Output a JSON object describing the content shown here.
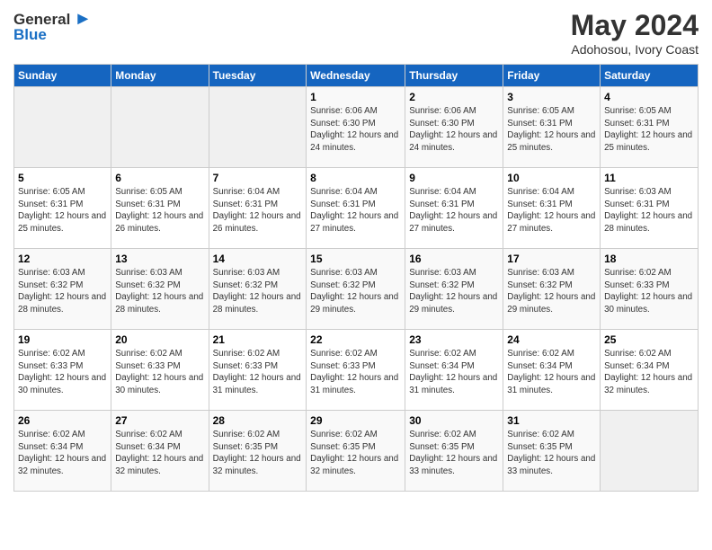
{
  "app": {
    "logo_general": "General",
    "logo_blue": "Blue",
    "month": "May 2024",
    "location": "Adohosou, Ivory Coast"
  },
  "calendar": {
    "headers": [
      "Sunday",
      "Monday",
      "Tuesday",
      "Wednesday",
      "Thursday",
      "Friday",
      "Saturday"
    ],
    "rows": [
      [
        {
          "day": "",
          "info": ""
        },
        {
          "day": "",
          "info": ""
        },
        {
          "day": "",
          "info": ""
        },
        {
          "day": "1",
          "info": "Sunrise: 6:06 AM\nSunset: 6:30 PM\nDaylight: 12 hours\nand 24 minutes."
        },
        {
          "day": "2",
          "info": "Sunrise: 6:06 AM\nSunset: 6:30 PM\nDaylight: 12 hours\nand 24 minutes."
        },
        {
          "day": "3",
          "info": "Sunrise: 6:05 AM\nSunset: 6:31 PM\nDaylight: 12 hours\nand 25 minutes."
        },
        {
          "day": "4",
          "info": "Sunrise: 6:05 AM\nSunset: 6:31 PM\nDaylight: 12 hours\nand 25 minutes."
        }
      ],
      [
        {
          "day": "5",
          "info": "Sunrise: 6:05 AM\nSunset: 6:31 PM\nDaylight: 12 hours\nand 25 minutes."
        },
        {
          "day": "6",
          "info": "Sunrise: 6:05 AM\nSunset: 6:31 PM\nDaylight: 12 hours\nand 26 minutes."
        },
        {
          "day": "7",
          "info": "Sunrise: 6:04 AM\nSunset: 6:31 PM\nDaylight: 12 hours\nand 26 minutes."
        },
        {
          "day": "8",
          "info": "Sunrise: 6:04 AM\nSunset: 6:31 PM\nDaylight: 12 hours\nand 27 minutes."
        },
        {
          "day": "9",
          "info": "Sunrise: 6:04 AM\nSunset: 6:31 PM\nDaylight: 12 hours\nand 27 minutes."
        },
        {
          "day": "10",
          "info": "Sunrise: 6:04 AM\nSunset: 6:31 PM\nDaylight: 12 hours\nand 27 minutes."
        },
        {
          "day": "11",
          "info": "Sunrise: 6:03 AM\nSunset: 6:31 PM\nDaylight: 12 hours\nand 28 minutes."
        }
      ],
      [
        {
          "day": "12",
          "info": "Sunrise: 6:03 AM\nSunset: 6:32 PM\nDaylight: 12 hours\nand 28 minutes."
        },
        {
          "day": "13",
          "info": "Sunrise: 6:03 AM\nSunset: 6:32 PM\nDaylight: 12 hours\nand 28 minutes."
        },
        {
          "day": "14",
          "info": "Sunrise: 6:03 AM\nSunset: 6:32 PM\nDaylight: 12 hours\nand 28 minutes."
        },
        {
          "day": "15",
          "info": "Sunrise: 6:03 AM\nSunset: 6:32 PM\nDaylight: 12 hours\nand 29 minutes."
        },
        {
          "day": "16",
          "info": "Sunrise: 6:03 AM\nSunset: 6:32 PM\nDaylight: 12 hours\nand 29 minutes."
        },
        {
          "day": "17",
          "info": "Sunrise: 6:03 AM\nSunset: 6:32 PM\nDaylight: 12 hours\nand 29 minutes."
        },
        {
          "day": "18",
          "info": "Sunrise: 6:02 AM\nSunset: 6:33 PM\nDaylight: 12 hours\nand 30 minutes."
        }
      ],
      [
        {
          "day": "19",
          "info": "Sunrise: 6:02 AM\nSunset: 6:33 PM\nDaylight: 12 hours\nand 30 minutes."
        },
        {
          "day": "20",
          "info": "Sunrise: 6:02 AM\nSunset: 6:33 PM\nDaylight: 12 hours\nand 30 minutes."
        },
        {
          "day": "21",
          "info": "Sunrise: 6:02 AM\nSunset: 6:33 PM\nDaylight: 12 hours\nand 31 minutes."
        },
        {
          "day": "22",
          "info": "Sunrise: 6:02 AM\nSunset: 6:33 PM\nDaylight: 12 hours\nand 31 minutes."
        },
        {
          "day": "23",
          "info": "Sunrise: 6:02 AM\nSunset: 6:34 PM\nDaylight: 12 hours\nand 31 minutes."
        },
        {
          "day": "24",
          "info": "Sunrise: 6:02 AM\nSunset: 6:34 PM\nDaylight: 12 hours\nand 31 minutes."
        },
        {
          "day": "25",
          "info": "Sunrise: 6:02 AM\nSunset: 6:34 PM\nDaylight: 12 hours\nand 32 minutes."
        }
      ],
      [
        {
          "day": "26",
          "info": "Sunrise: 6:02 AM\nSunset: 6:34 PM\nDaylight: 12 hours\nand 32 minutes."
        },
        {
          "day": "27",
          "info": "Sunrise: 6:02 AM\nSunset: 6:34 PM\nDaylight: 12 hours\nand 32 minutes."
        },
        {
          "day": "28",
          "info": "Sunrise: 6:02 AM\nSunset: 6:35 PM\nDaylight: 12 hours\nand 32 minutes."
        },
        {
          "day": "29",
          "info": "Sunrise: 6:02 AM\nSunset: 6:35 PM\nDaylight: 12 hours\nand 32 minutes."
        },
        {
          "day": "30",
          "info": "Sunrise: 6:02 AM\nSunset: 6:35 PM\nDaylight: 12 hours\nand 33 minutes."
        },
        {
          "day": "31",
          "info": "Sunrise: 6:02 AM\nSunset: 6:35 PM\nDaylight: 12 hours\nand 33 minutes."
        },
        {
          "day": "",
          "info": ""
        }
      ]
    ]
  }
}
